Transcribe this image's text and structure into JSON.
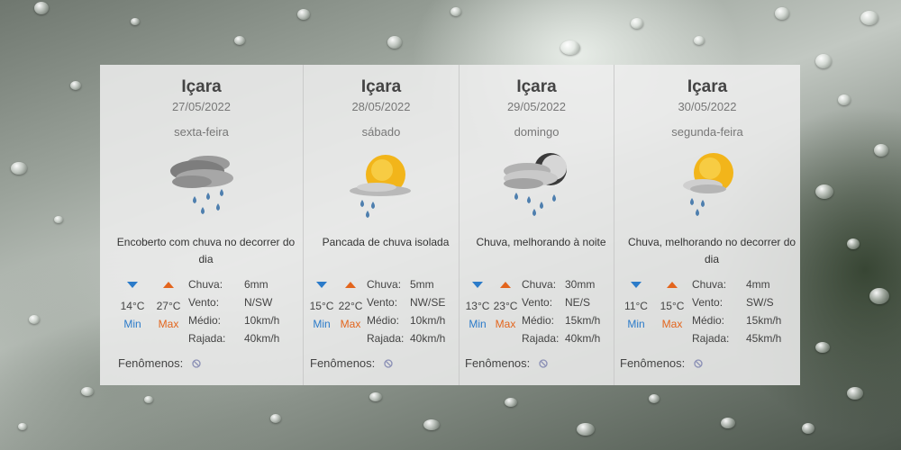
{
  "colors": {
    "min": "#2b7bc9",
    "max": "#e3651d"
  },
  "labels": {
    "min": "Min",
    "max": "Max",
    "chuva": "Chuva:",
    "vento": "Vento:",
    "medio": "Médio:",
    "rajada": "Rajada:",
    "fenomenos": "Fenômenos:"
  },
  "days": [
    {
      "city": "Içara",
      "date": "27/05/2022",
      "weekday": "sexta-feira",
      "icon": "rain-cloudy-icon",
      "description": "Encoberto com chuva no decorrer do dia",
      "min": "14°C",
      "max": "27°C",
      "chuva": "6mm",
      "vento": "N/SW",
      "medio": "10km/h",
      "rajada": "40km/h",
      "fenomenos_icon": "none-icon"
    },
    {
      "city": "Içara",
      "date": "28/05/2022",
      "weekday": "sábado",
      "icon": "sun-rain-icon",
      "description": "Pancada de chuva isolada",
      "min": "15°C",
      "max": "22°C",
      "chuva": "5mm",
      "vento": "NW/SE",
      "medio": "10km/h",
      "rajada": "40km/h",
      "fenomenos_icon": "none-icon"
    },
    {
      "city": "Içara",
      "date": "29/05/2022",
      "weekday": "domingo",
      "icon": "moon-rain-icon",
      "description": "Chuva, melhorando à noite",
      "min": "13°C",
      "max": "23°C",
      "chuva": "30mm",
      "vento": "NE/S",
      "medio": "15km/h",
      "rajada": "40km/h",
      "fenomenos_icon": "none-icon"
    },
    {
      "city": "Içara",
      "date": "30/05/2022",
      "weekday": "segunda-feira",
      "icon": "sun-cloud-rain-icon",
      "description": "Chuva, melhorando no decorrer do dia",
      "min": "11°C",
      "max": "15°C",
      "chuva": "4mm",
      "vento": "SW/S",
      "medio": "15km/h",
      "rajada": "45km/h",
      "fenomenos_icon": "none-icon"
    }
  ]
}
